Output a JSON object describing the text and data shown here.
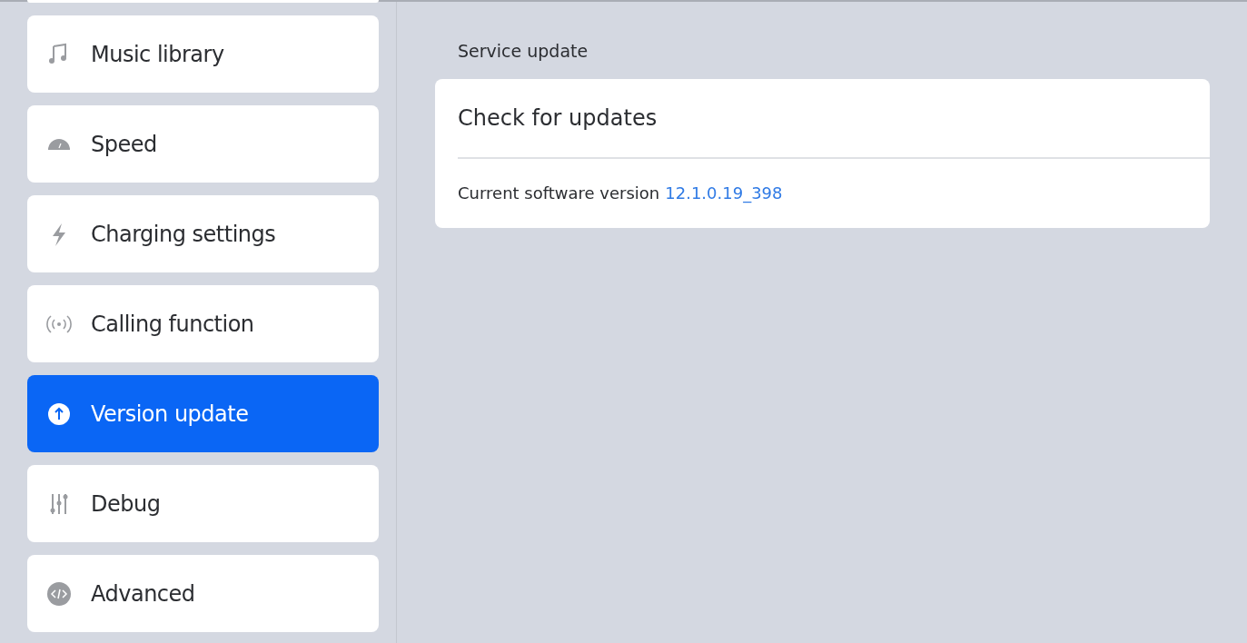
{
  "sidebar": {
    "items": [
      {
        "label": "Music library",
        "selected": false
      },
      {
        "label": "Speed",
        "selected": false
      },
      {
        "label": "Charging settings",
        "selected": false
      },
      {
        "label": "Calling function",
        "selected": false
      },
      {
        "label": "Version update",
        "selected": true
      },
      {
        "label": "Debug",
        "selected": false
      },
      {
        "label": "Advanced",
        "selected": false
      }
    ]
  },
  "section": {
    "title": "Service update",
    "card": {
      "action": "Check for updates",
      "version_label": "Current software version",
      "version_value": "12.1.0.19_398"
    }
  }
}
